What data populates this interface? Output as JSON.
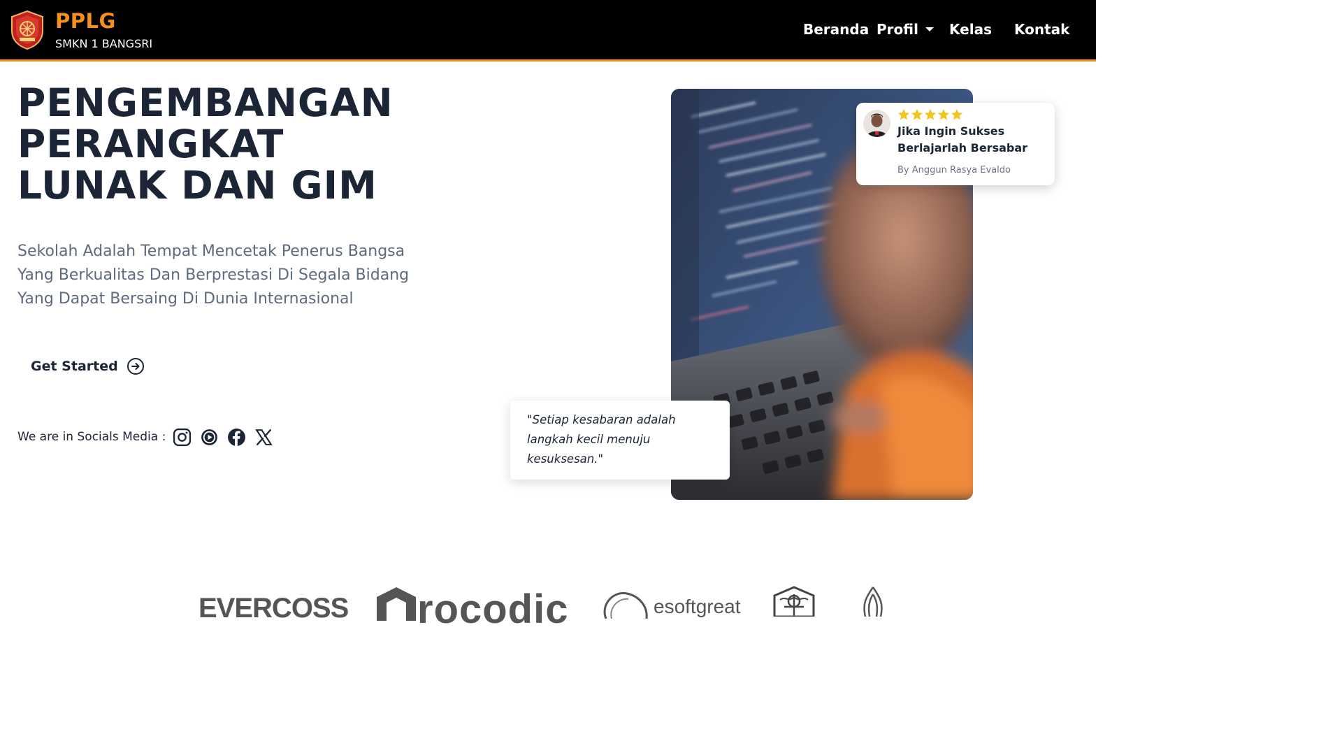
{
  "brand": {
    "title": "PPLG",
    "subtitle": "SMKN 1 BANGSRI"
  },
  "nav": {
    "beranda": "Beranda",
    "profil": "Profil",
    "kelas": "Kelas",
    "kontak": "Kontak"
  },
  "hero": {
    "title_lines": [
      "PENGEMBANGAN",
      "PERANGKAT",
      "LUNAK DAN GIM"
    ],
    "description_lines": [
      "Sekolah Adalah Tempat Mencetak Penerus Bangsa",
      "Yang Berkualitas Dan Berprestasi Di Segala Bidang",
      "Yang Dapat Bersaing Di Dunia Internasional"
    ],
    "cta_label": "Get Started"
  },
  "socials": {
    "label": "We are in Socials Media :",
    "icons": [
      "instagram-icon",
      "play-circle-icon",
      "facebook-icon",
      "x-icon"
    ]
  },
  "review": {
    "rating": 5,
    "text_lines": [
      "Jika Ingin Sukses",
      "Berlajarlah Bersabar"
    ],
    "author": "By Anggun Rasya Evaldo"
  },
  "quote": {
    "text_lines": [
      "\"Setiap kesabaran adalah",
      "langkah kecil menuju",
      "kesuksesan.\""
    ]
  },
  "partners": {
    "evercoss": "EVERCOSS",
    "crocodic": "rocodic",
    "esoftgreat": "esoftgreat"
  },
  "colors": {
    "accent": "#f5901e",
    "navbar_bg": "#000000",
    "heading": "#1c2536",
    "muted": "#5e6a7e",
    "star": "#f6c21b"
  }
}
